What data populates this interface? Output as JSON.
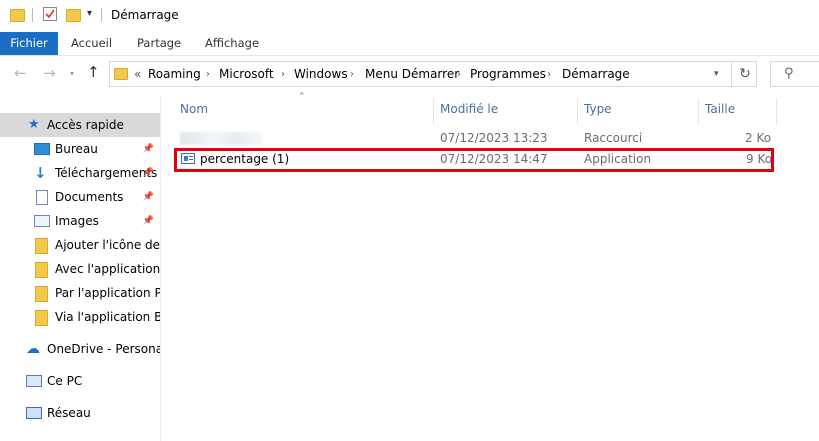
{
  "window": {
    "title": "Démarrage"
  },
  "ribbon": {
    "tabs": [
      "Fichier",
      "Accueil",
      "Partage",
      "Affichage"
    ]
  },
  "address": {
    "overflow": "«",
    "breadcrumbs": [
      "Roaming",
      "Microsoft",
      "Windows",
      "Menu Démarrer",
      "Programmes",
      "Démarrage"
    ]
  },
  "search": {
    "icon": "search-icon"
  },
  "sidebar": {
    "quick_access": "Accès rapide",
    "pinned": [
      {
        "label": "Bureau",
        "icon": "desktop-icon"
      },
      {
        "label": "Téléchargements",
        "icon": "download-icon"
      },
      {
        "label": "Documents",
        "icon": "documents-icon"
      },
      {
        "label": "Images",
        "icon": "images-icon"
      }
    ],
    "folders": [
      "Ajouter l'icône de la",
      "Avec l'application d",
      "Par l'application Per",
      "Via l'application Bat"
    ],
    "onedrive": "OneDrive - Personal",
    "thispc": "Ce PC",
    "network": "Réseau"
  },
  "columns": {
    "name": "Nom",
    "modified": "Modifié le",
    "type": "Type",
    "size": "Taille"
  },
  "files": [
    {
      "name": "",
      "modified": "07/12/2023 13:23",
      "type": "Raccourci",
      "size": "2 Ko"
    },
    {
      "name": "percentage (1)",
      "modified": "07/12/2023 14:47",
      "type": "Application",
      "size": "9 Ko"
    }
  ],
  "colors": {
    "accent": "#1a6fc4",
    "highlight": "#e0000e",
    "folder": "#f2c94c"
  }
}
